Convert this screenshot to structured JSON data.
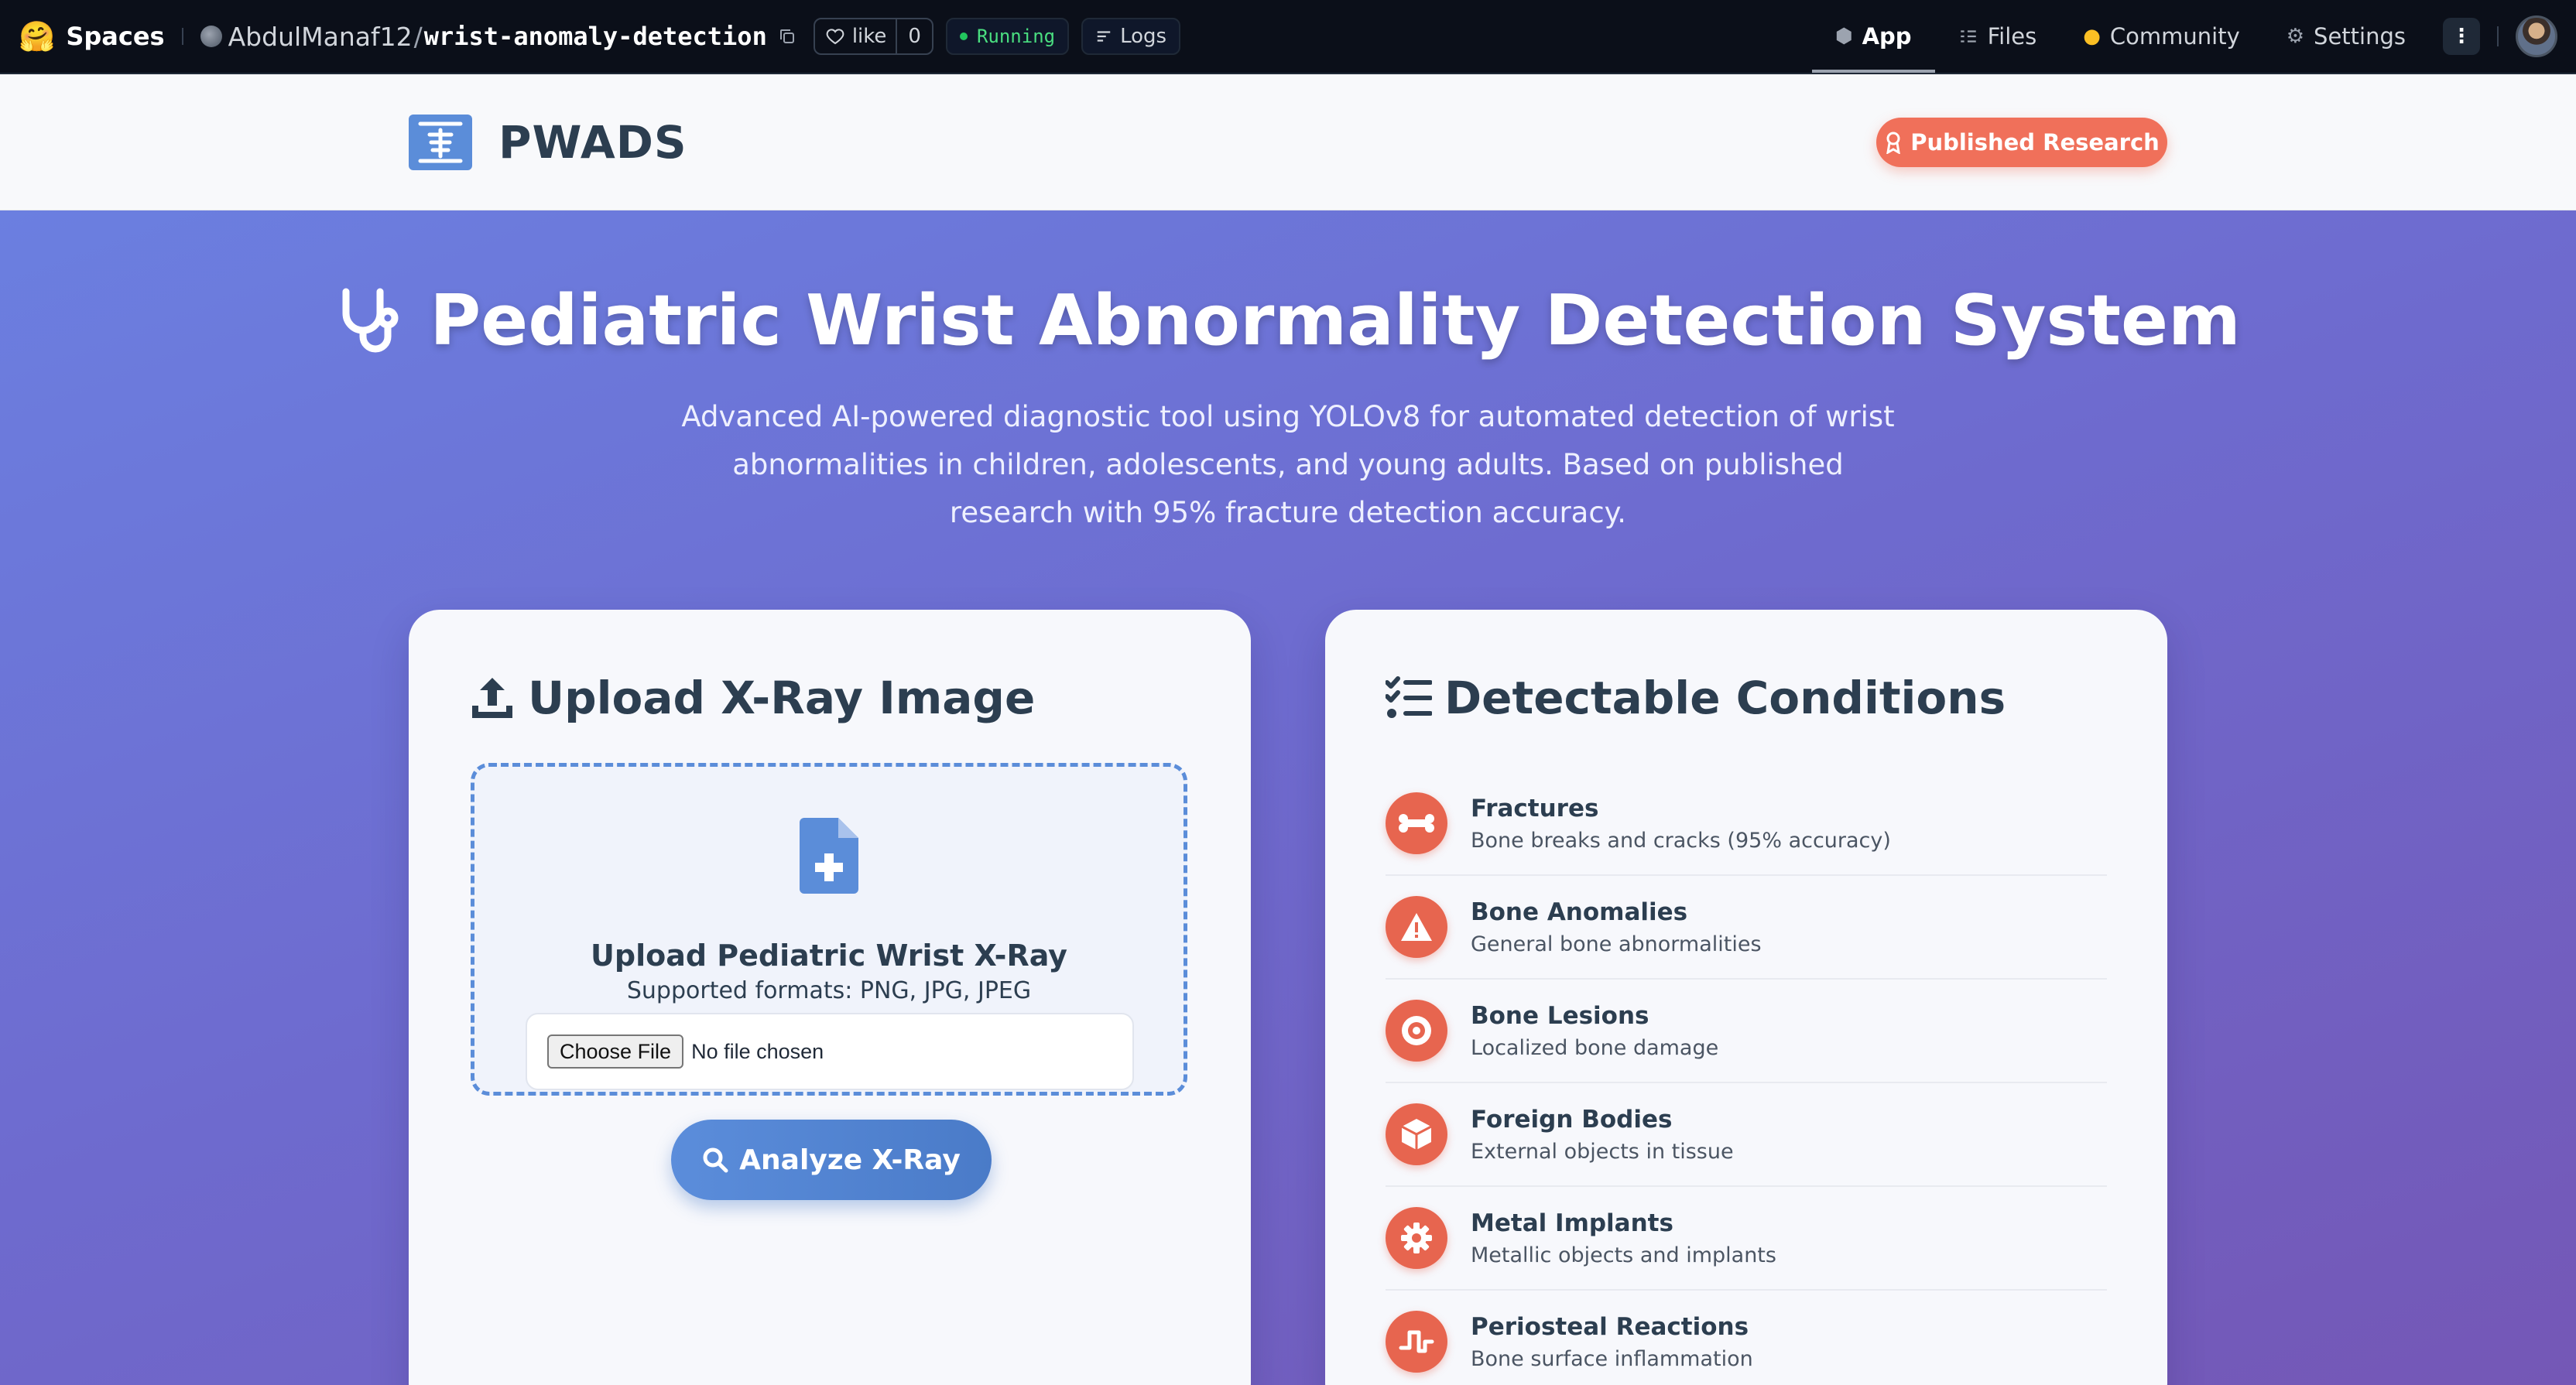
{
  "hf_bar": {
    "spaces_label": "Spaces",
    "owner": "AbdulManaf12",
    "separator": "/",
    "repo": "wrist-anomaly-detection",
    "like_label": "like",
    "like_count": "0",
    "status": "Running",
    "logs_label": "Logs",
    "tabs": [
      {
        "label": "App",
        "icon": "cube-icon",
        "active": true
      },
      {
        "label": "Files",
        "icon": "files-icon",
        "active": false
      },
      {
        "label": "Community",
        "icon": "community-icon",
        "active": false
      },
      {
        "label": "Settings",
        "icon": "gear-icon",
        "active": false
      }
    ]
  },
  "header": {
    "brand": "PWADS",
    "research_button": "Published Research"
  },
  "hero": {
    "title": "Pediatric Wrist Abnormality Detection System",
    "subtitle": "Advanced AI-powered diagnostic tool using YOLOv8 for automated detection of wrist abnormalities in children, adolescents, and young adults. Based on published research with 95% fracture detection accuracy."
  },
  "upload": {
    "title": "Upload X-Ray Image",
    "dropzone_title": "Upload Pediatric Wrist X-Ray",
    "formats": "Supported formats: PNG, JPG, JPEG",
    "choose_file": "Choose File",
    "no_file": "No file chosen",
    "analyze_button": "Analyze X-Ray"
  },
  "conditions": {
    "title": "Detectable Conditions",
    "items": [
      {
        "name": "Fractures",
        "desc": "Bone breaks and cracks (95% accuracy)",
        "icon": "bone-icon"
      },
      {
        "name": "Bone Anomalies",
        "desc": "General bone abnormalities",
        "icon": "warning-icon"
      },
      {
        "name": "Bone Lesions",
        "desc": "Localized bone damage",
        "icon": "bullseye-icon"
      },
      {
        "name": "Foreign Bodies",
        "desc": "External objects in tissue",
        "icon": "cube-icon"
      },
      {
        "name": "Metal Implants",
        "desc": "Metallic objects and implants",
        "icon": "cog-icon"
      },
      {
        "name": "Periosteal Reactions",
        "desc": "Bone surface inflammation",
        "icon": "wave-icon"
      }
    ]
  },
  "colors": {
    "accent_blue": "#5b8dd9",
    "accent_coral": "#e7654f",
    "gradient_start": "#6b7fe0",
    "gradient_end": "#7457b6",
    "status_green": "#22c55e"
  }
}
